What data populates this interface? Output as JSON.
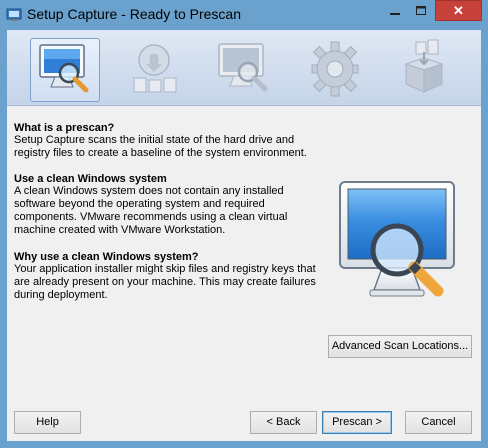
{
  "window": {
    "title": "Setup Capture - Ready to Prescan",
    "close_glyph": "✕",
    "min_glyph": "—",
    "max_glyph": "□"
  },
  "steps": [
    {
      "name": "prescan-step",
      "icon": "monitor-magnifier-icon",
      "active": true
    },
    {
      "name": "install-step",
      "icon": "disc-install-icon",
      "active": false
    },
    {
      "name": "postscan-step",
      "icon": "monitor-magnifier-icon",
      "active": false
    },
    {
      "name": "configure-step",
      "icon": "gear-icon",
      "active": false
    },
    {
      "name": "build-step",
      "icon": "package-icon",
      "active": false
    }
  ],
  "sections": [
    {
      "heading": "What is a prescan?",
      "lines": [
        "Setup Capture scans the initial state of the hard drive and",
        "registry files to create a baseline of the system environment."
      ]
    },
    {
      "heading": "Use a clean Windows system",
      "lines": [
        "A clean Windows system does not contain any installed",
        "software beyond the operating system and required",
        "components. VMware recommends using a clean virtual",
        "machine created with VMware Workstation."
      ]
    },
    {
      "heading": "Why use a clean Windows system?",
      "lines": [
        "Your application installer might skip files and registry keys that",
        "are already present on your machine. This may create failures",
        "during deployment."
      ]
    }
  ],
  "buttons": {
    "advanced": "Advanced Scan Locations...",
    "help": "Help",
    "back": "< Back",
    "prescan": "Prescan >",
    "cancel": "Cancel"
  },
  "colors": {
    "frame": "#6aa2cd",
    "close": "#c7413b",
    "client": "#f0f0f0",
    "accent_border": "#3c7fb1"
  }
}
